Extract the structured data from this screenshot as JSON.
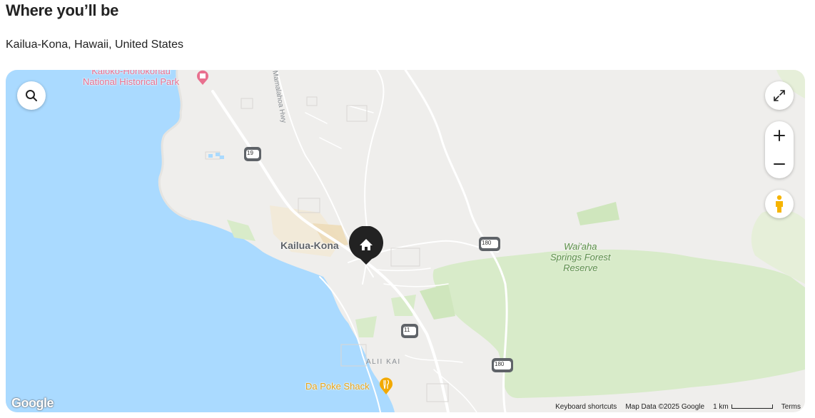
{
  "section": {
    "title": "Where you’ll be",
    "location": "Kailua-Kona, Hawaii, United States"
  },
  "map": {
    "labels": {
      "town": "Kailua-Kona",
      "park_line1": "Kaloko-Honokohau",
      "park_line2": "National Historical Park",
      "forest_line1": "Wai'aha",
      "forest_line2": "Springs Forest",
      "forest_line3": "Reserve",
      "restaurant": "Da Poke Shack",
      "area": "ALII KAI",
      "highway_name": "Mamalahoa Hwy"
    },
    "route_shields": {
      "r19": "19",
      "r180_upper": "180",
      "r11": "11",
      "r180_lower": "180"
    },
    "controls": {
      "search_icon": "search-icon",
      "fullscreen_icon": "expand-icon",
      "zoom_in_icon": "plus-icon",
      "zoom_out_icon": "minus-icon",
      "street_view_icon": "pegman-icon"
    },
    "marker_icon": "home-icon",
    "footer": {
      "keyboard": "Keyboard shortcuts",
      "map_data": "Map Data ©2025 Google",
      "scale": "1 km",
      "terms": "Terms"
    },
    "logo": "Google",
    "colors": {
      "water": "#aadaff",
      "land": "#efeeec",
      "forest": "#d8ebc9",
      "marker": "#222222"
    }
  }
}
